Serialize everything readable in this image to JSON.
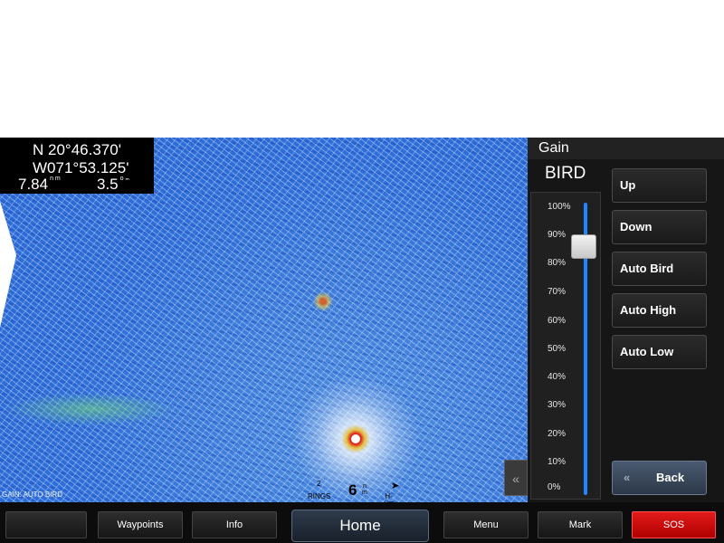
{
  "position": {
    "lat_line": "N  20°46.370'",
    "lon_line": "W071°53.125'",
    "distance": "7.84",
    "distance_unit": "n m",
    "speed": "3.5",
    "speed_unit": "o ₘ"
  },
  "radar": {
    "gain_status": "GAIN: AUTO BIRD",
    "rings_count": "2",
    "rings_label": "RINGS",
    "range_value": "6",
    "range_unit": "n m",
    "orientation": "H-UP",
    "orientation_icon": "north-arrow-icon",
    "collapse_label": "«"
  },
  "panel": {
    "title": "Gain",
    "mode": "BIRD",
    "scale": [
      "100%",
      "90%",
      "80%",
      "70%",
      "60%",
      "50%",
      "40%",
      "30%",
      "20%",
      "10%",
      "0%"
    ],
    "gain_level": 0.86,
    "buttons": [
      "Up",
      "Down",
      "Auto Bird",
      "Auto High",
      "Auto Low"
    ],
    "back_label": "Back",
    "back_icon": "«"
  },
  "bottom_bar": {
    "blank": "",
    "waypoints": "Waypoints",
    "info": "Info",
    "home": "Home",
    "menu": "Menu",
    "mark": "Mark",
    "sos": "SOS"
  },
  "colors": {
    "radar_blue": "#2d6ed8",
    "slider_blue": "#1e86ff",
    "sos_red": "#d40f0f"
  }
}
